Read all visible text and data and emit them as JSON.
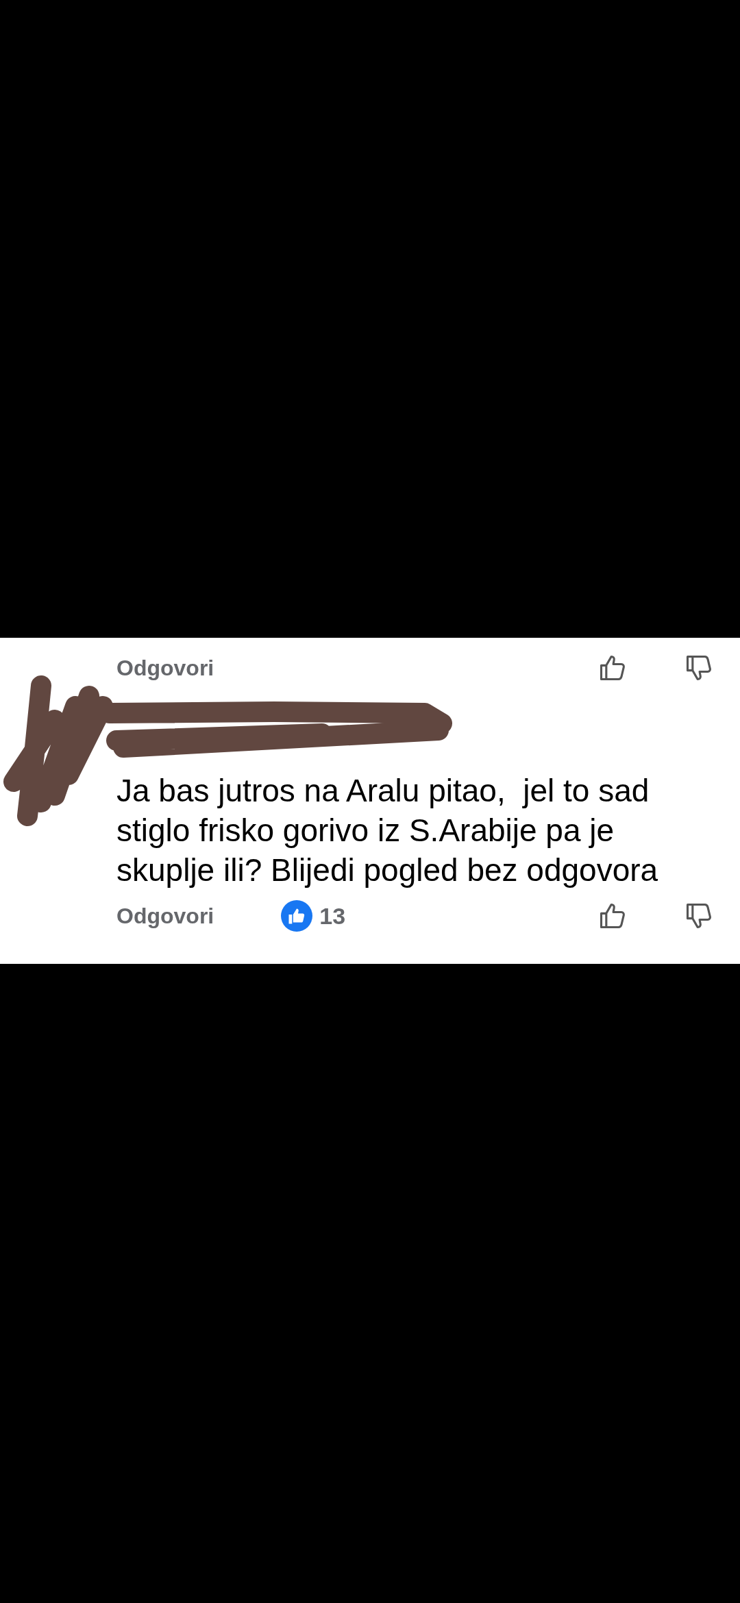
{
  "top_row": {
    "reply_label": "Odgovori"
  },
  "comment": {
    "text": "Ja bas jutros na Aralu pitao,  jel to sad stiglo frisko gorivo iz S.Arabije pa je skuplje ili? Blijedi pogled bez odgovora",
    "reply_label": "Odgovori",
    "likes_count": "13"
  }
}
